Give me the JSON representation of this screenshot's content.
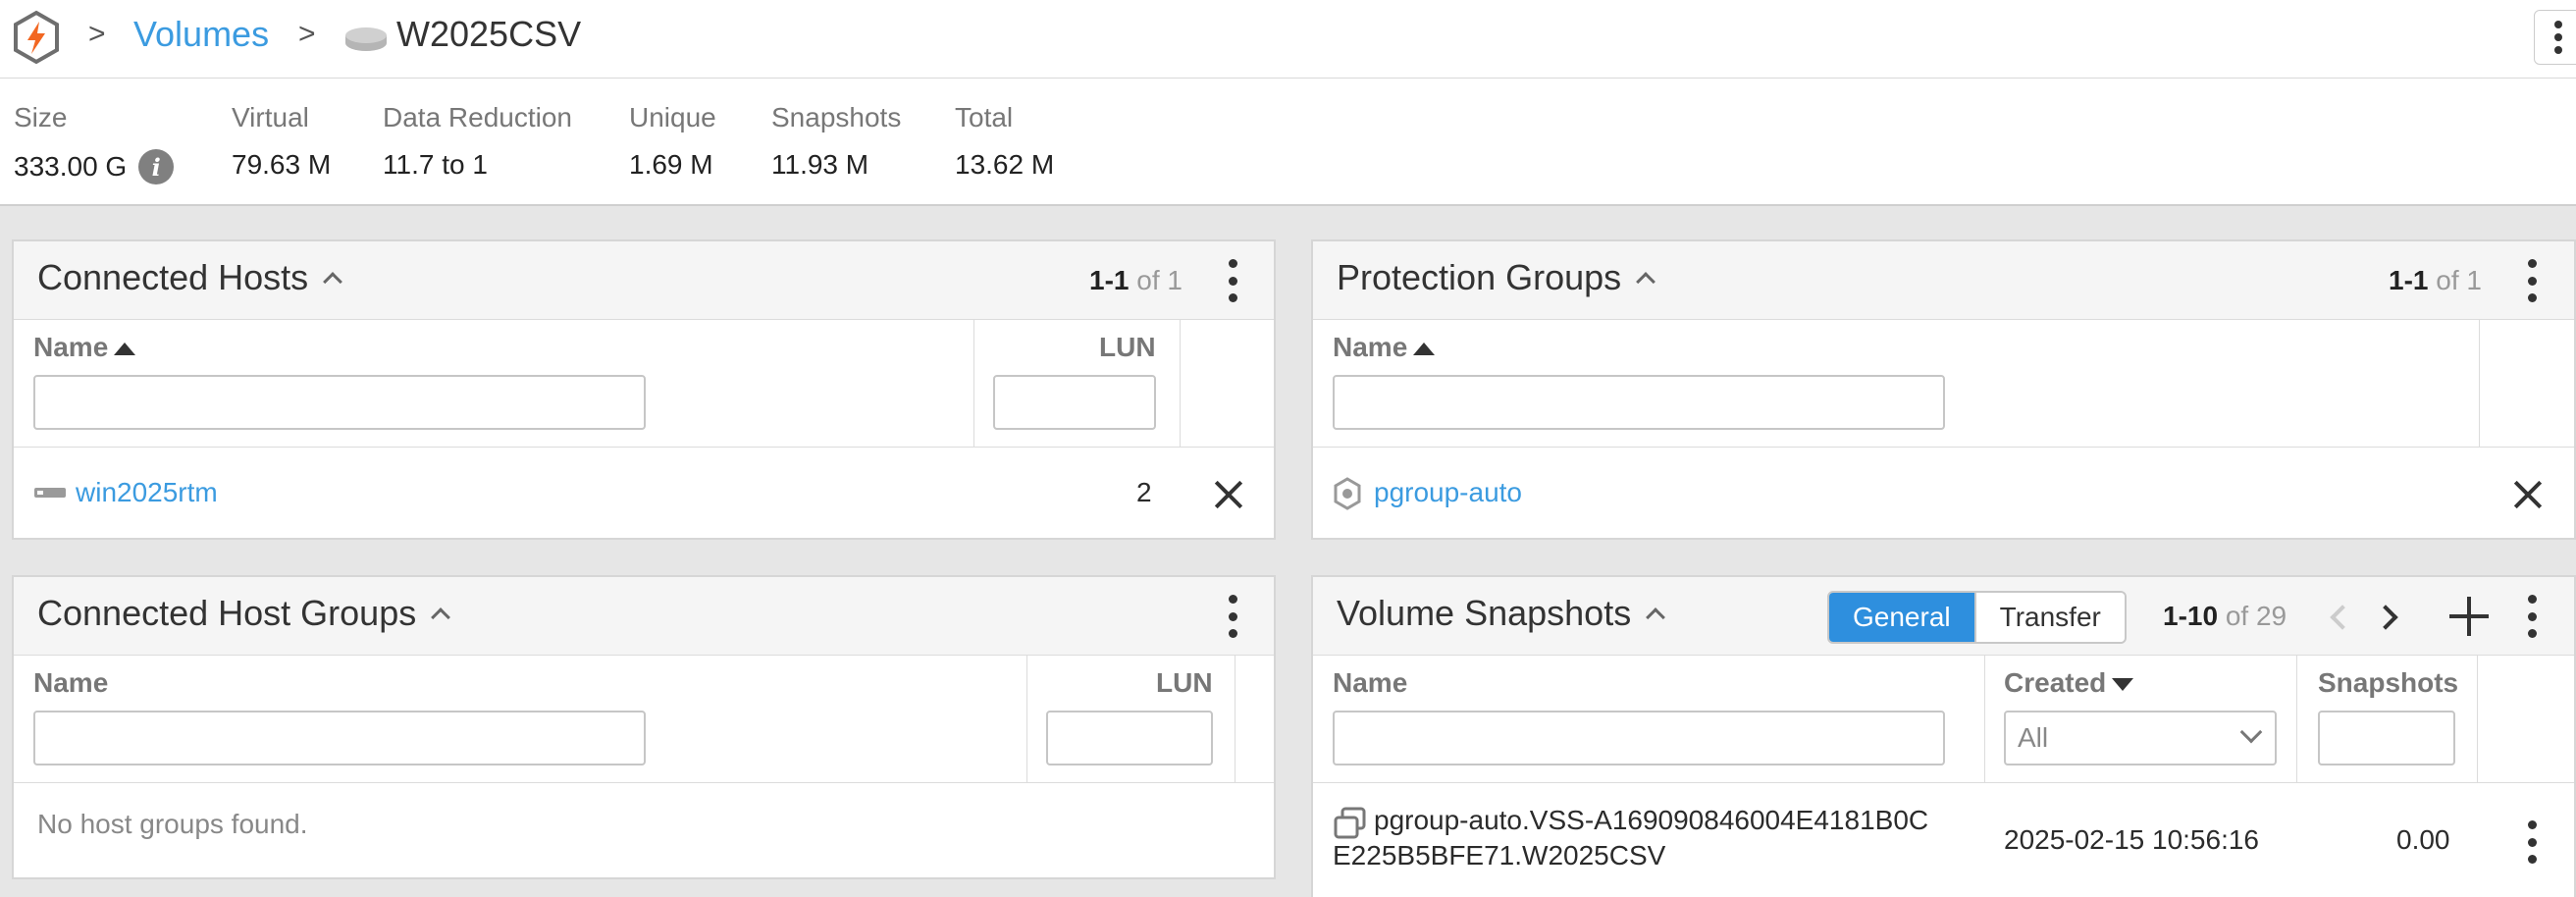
{
  "breadcrumb": {
    "sep": ">",
    "volumes": "Volumes",
    "title": "W2025CSV"
  },
  "stats": [
    {
      "label": "Size",
      "value": "333.00 G"
    },
    {
      "label": "Virtual",
      "value": "79.63 M"
    },
    {
      "label": "Data Reduction",
      "value": "11.7 to 1"
    },
    {
      "label": "Unique",
      "value": "1.69 M"
    },
    {
      "label": "Snapshots",
      "value": "11.93 M"
    },
    {
      "label": "Total",
      "value": "13.62 M"
    }
  ],
  "info_glyph": "i",
  "connected_hosts": {
    "title": "Connected Hosts",
    "range": "1-1",
    "of": "of 1",
    "col_name": "Name",
    "col_lun": "LUN",
    "rows": [
      {
        "name": "win2025rtm",
        "lun": "2"
      }
    ]
  },
  "protection_groups": {
    "title": "Protection Groups",
    "range": "1-1",
    "of": "of 1",
    "col_name": "Name",
    "rows": [
      {
        "name": "pgroup-auto"
      }
    ]
  },
  "connected_host_groups": {
    "title": "Connected Host Groups",
    "col_name": "Name",
    "col_lun": "LUN",
    "empty": "No host groups found."
  },
  "volume_snapshots": {
    "title": "Volume Snapshots",
    "tab_general": "General",
    "tab_transfer": "Transfer",
    "range": "1-10",
    "of": "of 29",
    "col_name": "Name",
    "col_created": "Created",
    "col_snapshots": "Snapshots",
    "created_filter": "All",
    "rows": [
      {
        "name_line1": "pgroup-auto.VSS-A169090846004E4181B0C",
        "name_line2": "E225B5BFE71.W2025CSV",
        "created": "2025-02-15 10:56:16",
        "snapshots": "0.00"
      }
    ]
  },
  "colors": {
    "accent": "#3b9be0",
    "active_tab": "#2e8fde",
    "logo_orange": "#f26722"
  }
}
